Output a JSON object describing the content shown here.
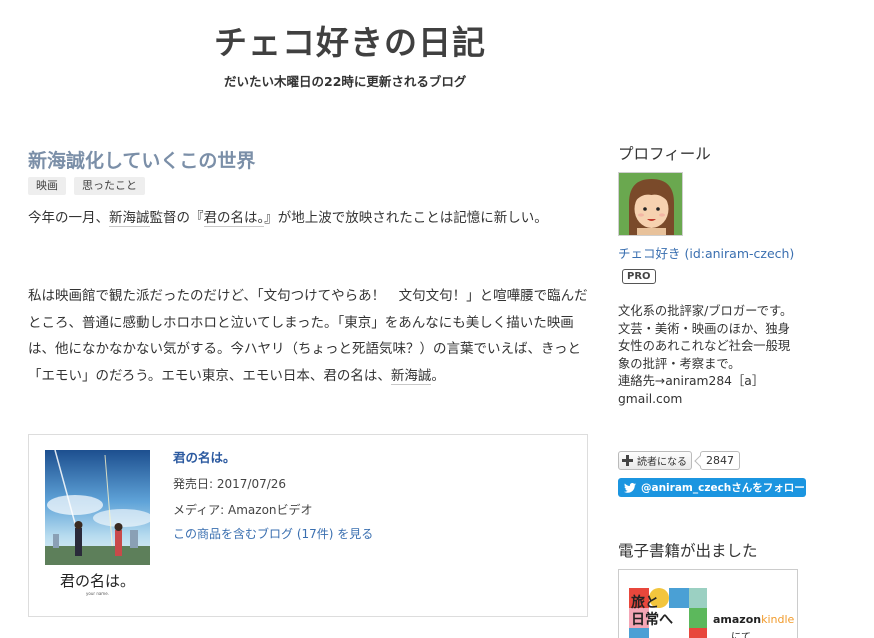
{
  "header": {
    "title": "チェコ好きの日記",
    "description": "だいたい木曜日の22時に更新されるブログ"
  },
  "entry": {
    "title": "新海誠化していくこの世界",
    "categories": [
      "映画",
      "思ったこと"
    ],
    "p1": {
      "a": "今年の一月、",
      "k1": "新海誠",
      "b": "監督の『",
      "k2": "君の名は。",
      "c": "』が地上波で放映されたことは記憶に新しい。"
    },
    "p2": {
      "a": "私は映画館で観た派だったのだけど、「文句つけてやらあ！　文句文句！」と喧嘩腰で臨んだところ、普通に感動しホロホロと泣いてしまった。「東京」をあんなにも美しく描いた映画は、他になかなかない気がする。今ハヤリ（ちょっと死語気味？）の言葉でいえば、きっと「エモい」のだろう。エモい東京、エモい日本、君の名は、",
      "k1": "新海誠",
      "b": "。"
    }
  },
  "product": {
    "name": "君の名は。",
    "release": "発売日: 2017/07/26",
    "media": "メディア: Amazonビデオ",
    "link": "この商品を含むブログ (17件) を見る",
    "cover_title": "君の名は。",
    "cover_sub": "your name."
  },
  "sidebar": {
    "profile_title": "プロフィール",
    "profile_name": "チェコ好き (id:aniram-czech)",
    "pro_badge": "PRO",
    "profile_desc": "文化系の批評家/ブロガーです。文芸・美術・映画のほか、独身女性のあれこれなど社会一般現象の批評・考察まで。\n連絡先→aniram284［a］gmail.com",
    "reader_button": "読者になる",
    "reader_count": "2847",
    "twitter_button": "@aniram_czechさんをフォロー",
    "book_title": "電子書籍が出ました",
    "book_cover_text": "旅と\n日常へ",
    "amazon_label": "amazon",
    "amazon_kindle": "kindle",
    "amazon_sub": "にて"
  },
  "colors": {
    "title_link": "#7b8fa8",
    "link": "#3a6fb0",
    "twitter": "#1b95e0"
  }
}
